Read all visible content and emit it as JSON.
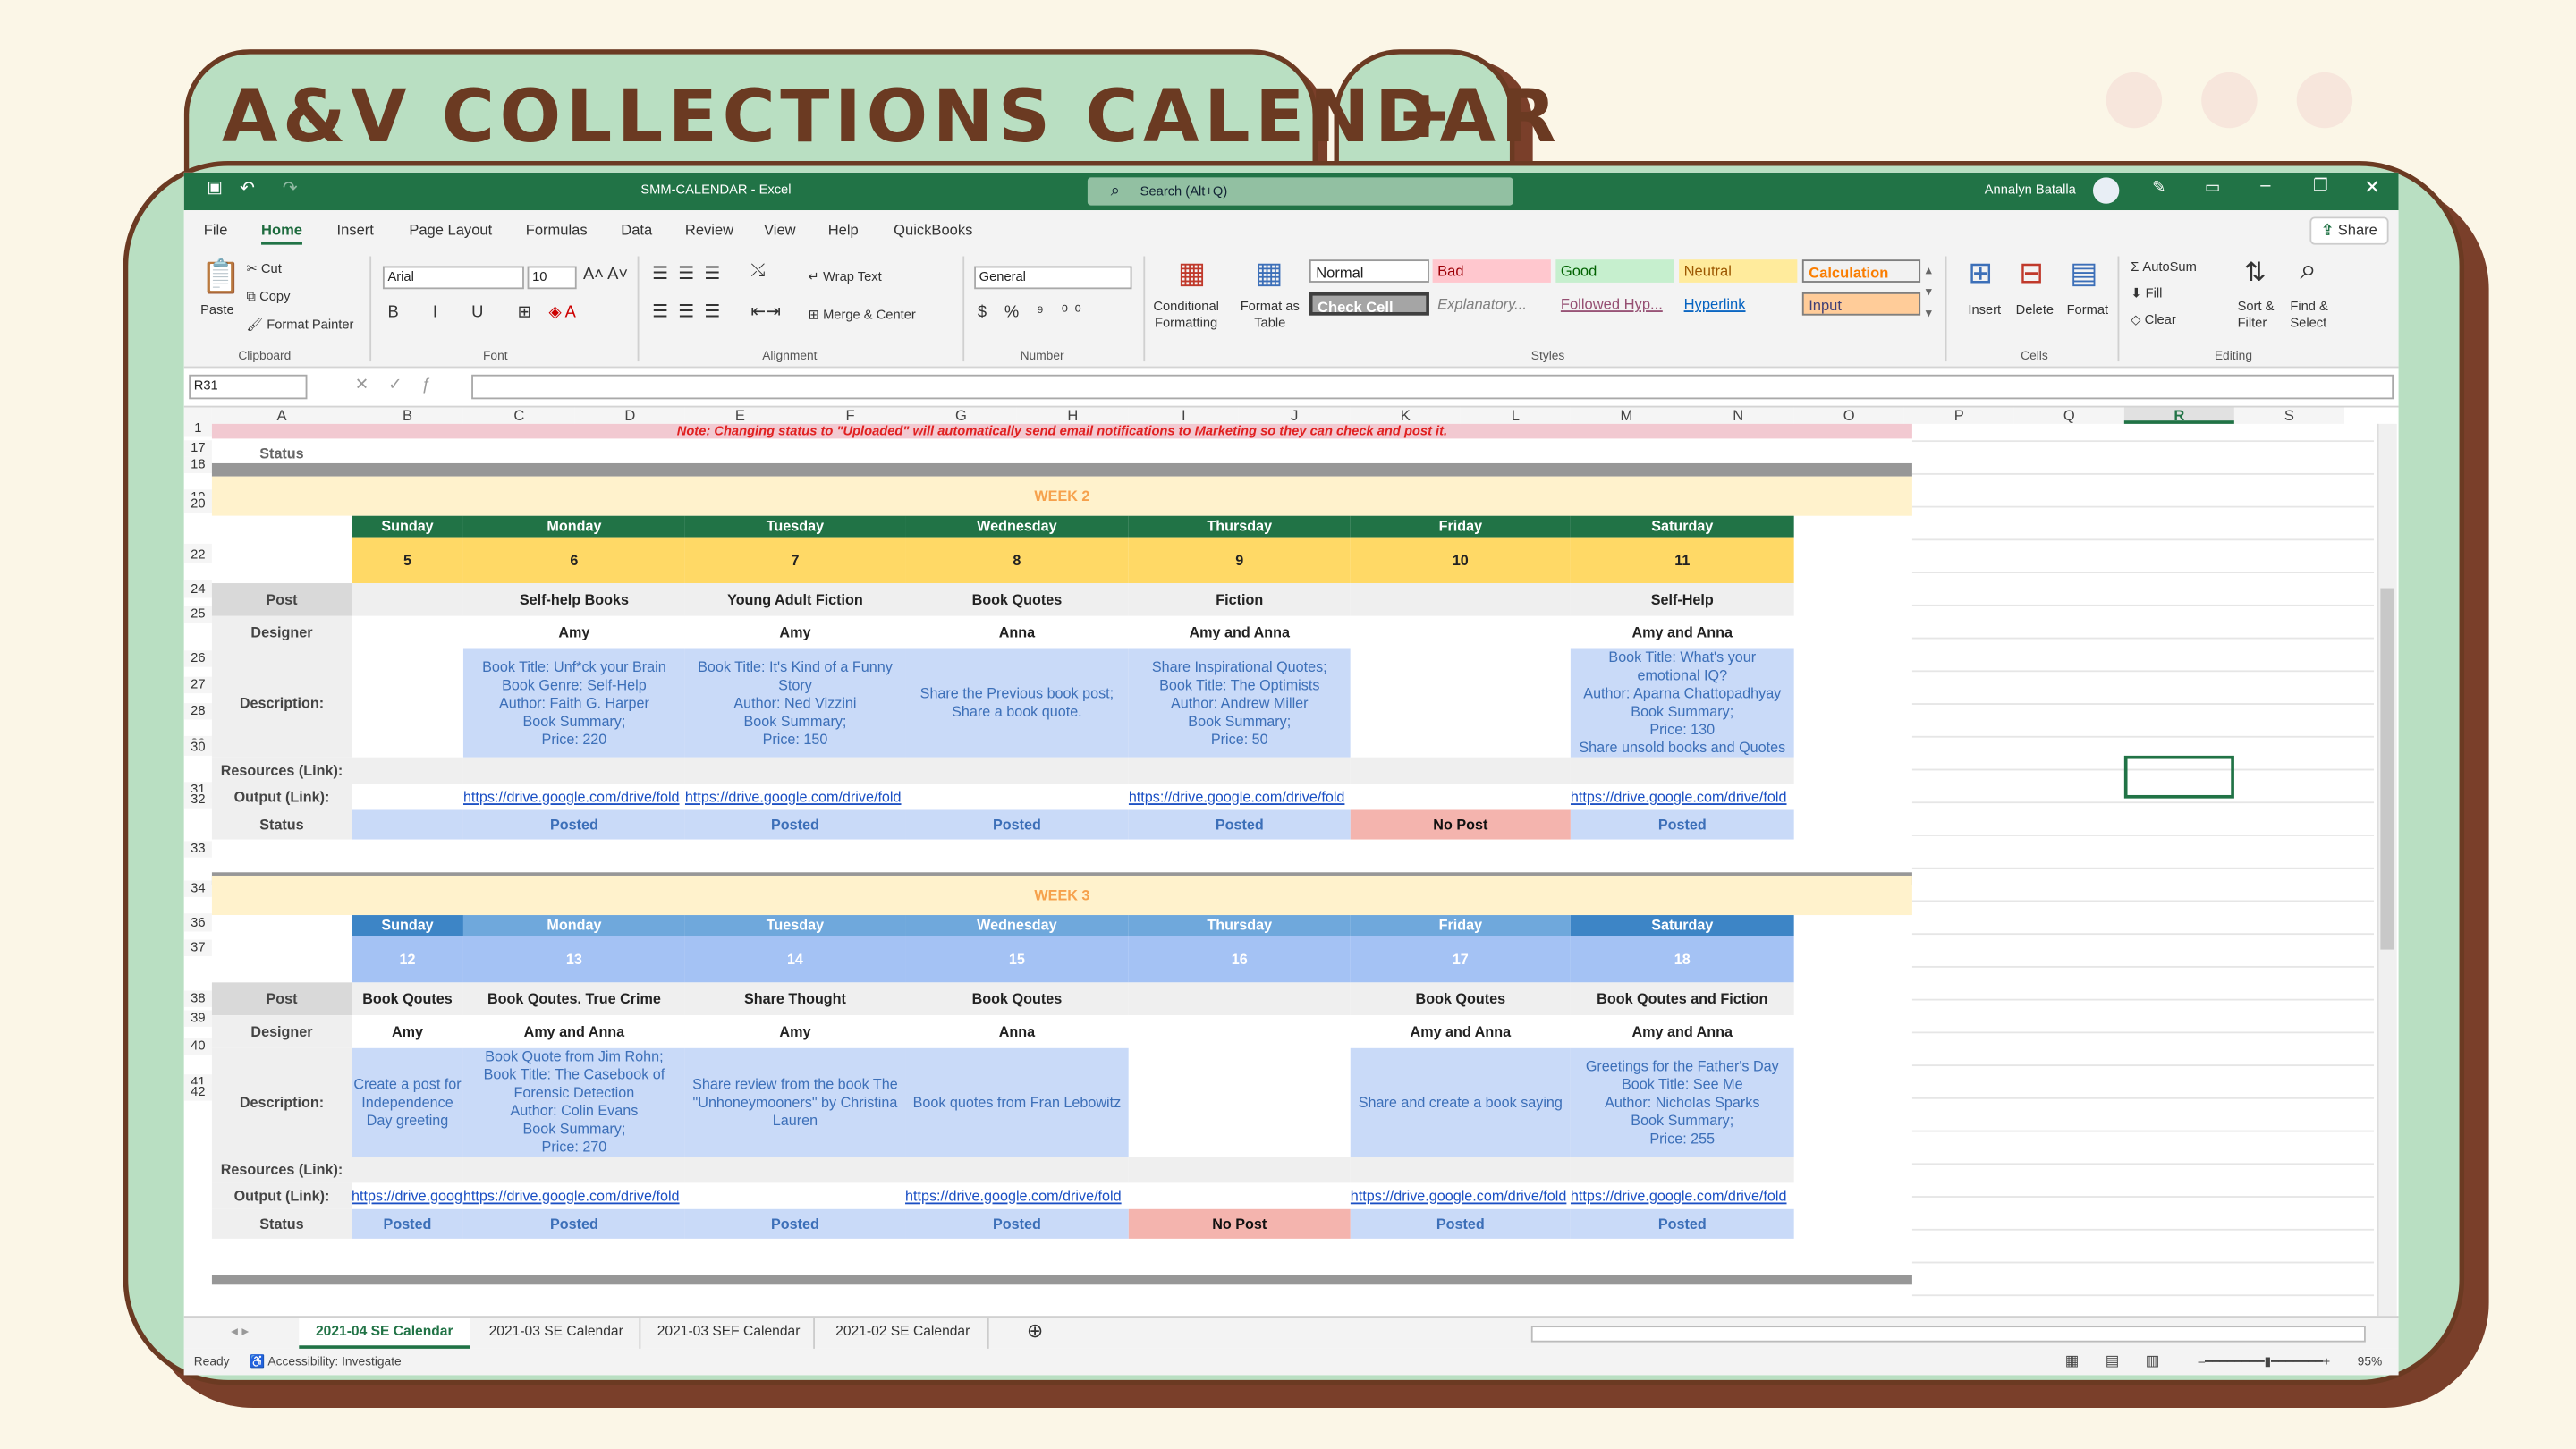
{
  "title": "A&V COLLECTIONS CALENDAR",
  "plus": "+",
  "window": {
    "title": "SMM-CALENDAR  -  Excel",
    "search": "Search (Alt+Q)",
    "user": "Annalyn Batalla"
  },
  "menu": [
    "File",
    "Home",
    "Insert",
    "Page Layout",
    "Formulas",
    "Data",
    "Review",
    "View",
    "Help",
    "QuickBooks"
  ],
  "share": "Share",
  "ribbon": {
    "clipboard": {
      "paste": "Paste",
      "cut": "Cut",
      "copy": "Copy",
      "format_painter": "Format Painter",
      "label": "Clipboard"
    },
    "font": {
      "name": "Arial",
      "size": "10",
      "label": "Font"
    },
    "alignment": {
      "wrap": "Wrap Text",
      "merge": "Merge & Center",
      "label": "Alignment"
    },
    "number": {
      "format": "General",
      "label": "Number"
    },
    "styles": {
      "cond": "Conditional\nFormatting",
      "table": "Format as\nTable",
      "normal": "Normal",
      "bad": "Bad",
      "good": "Good",
      "neutral": "Neutral",
      "calculation": "Calculation",
      "check": "Check Cell",
      "explanatory": "Explanatory...",
      "followed": "Followed Hyp...",
      "hyperlink": "Hyperlink",
      "input": "Input",
      "label": "Styles"
    },
    "cells": {
      "insert": "Insert",
      "delete": "Delete",
      "format": "Format",
      "label": "Cells"
    },
    "editing": {
      "autosum": "AutoSum",
      "fill": "Fill",
      "clear": "Clear",
      "sort": "Sort &\nFilter",
      "find": "Find &\nSelect",
      "label": "Editing"
    }
  },
  "namebox": "R31",
  "columns": [
    "A",
    "B",
    "C",
    "D",
    "E",
    "F",
    "G",
    "H",
    "I",
    "J",
    "K",
    "L",
    "M",
    "N",
    "O",
    "P",
    "Q",
    "R",
    "S"
  ],
  "note": "Note: Changing status to \"Uploaded\" will automatically send email notifications to Marketing so they can check and post it.",
  "labels": {
    "status": "Status",
    "post": "Post",
    "designer": "Designer",
    "description": "Description:",
    "resources": "Resources (Link):",
    "output": "Output (Link):"
  },
  "days": [
    "Sunday",
    "Monday",
    "Tuesday",
    "Wednesday",
    "Thursday",
    "Friday",
    "Saturday"
  ],
  "weeks": [
    {
      "title": "WEEK 2",
      "dates": [
        "5",
        "6",
        "7",
        "8",
        "9",
        "10",
        "11"
      ],
      "posts": [
        "",
        "Self-help Books",
        "Young Adult Fiction",
        "Book Quotes",
        "Fiction",
        "",
        "Self-Help"
      ],
      "designers": [
        "",
        "Amy",
        "Amy",
        "Anna",
        "Amy and Anna",
        "",
        "Amy and Anna"
      ],
      "descriptions": [
        "",
        "Book Title: Unf*ck your Brain\nBook Genre: Self-Help\nAuthor: Faith G. Harper\nBook Summary;\nPrice: 220",
        "Book Title: It's Kind of a Funny\nStory\nAuthor: Ned Vizzini\nBook Summary;\nPrice: 150",
        "Share the Previous book post;\nShare a book quote.",
        "Share Inspirational Quotes;\nBook Title: The Optimists\nAuthor: Andrew Miller\nBook Summary;\nPrice: 50",
        "",
        "Book Title: What's your\nemotional IQ?\nAuthor: Aparna Chattopadhyay\nBook Summary;\nPrice: 130\nShare unsold books and Quotes"
      ],
      "outputs": [
        "",
        "https://drive.google.com/drive/fold",
        "https://drive.google.com/drive/fold",
        "",
        "https://drive.google.com/drive/fold",
        "",
        "https://drive.google.com/drive/fold"
      ],
      "statuses": [
        "",
        "Posted",
        "Posted",
        "Posted",
        "Posted",
        "No Post",
        "Posted"
      ]
    },
    {
      "title": "WEEK 3",
      "dates": [
        "12",
        "13",
        "14",
        "15",
        "16",
        "17",
        "18"
      ],
      "posts": [
        "Book Qoutes",
        "Book Qoutes. True Crime",
        "Share Thought",
        "Book Qoutes",
        "",
        "Book Qoutes",
        "Book Qoutes and Fiction"
      ],
      "designers": [
        "Amy",
        "Amy and Anna",
        "Amy",
        "Anna",
        "",
        "Amy and Anna",
        "Amy and Anna"
      ],
      "descriptions": [
        "Create a post for Independence\nDay greeting",
        "Book Quote from Jim Rohn;\nBook Title: The Casebook of\nForensic Detection\nAuthor: Colin Evans\nBook Summary;\nPrice: 270",
        "Share review from the book The\n\"Unhoneymooners\" by Christina\nLauren",
        "Book quotes from Fran Lebowitz",
        "",
        "Share and create a book saying",
        "Greetings for the Father's Day\nBook Title: See Me\nAuthor: Nicholas Sparks\nBook Summary;\nPrice: 255"
      ],
      "outputs": [
        "https://drive.google.com/drive/fold",
        "https://drive.google.com/drive/fold",
        "",
        "https://drive.google.com/drive/fold",
        "",
        "https://drive.google.com/drive/fold",
        "https://drive.google.com/drive/fold"
      ],
      "statuses": [
        "Posted",
        "Posted",
        "Posted",
        "Posted",
        "No Post",
        "Posted",
        "Posted"
      ]
    }
  ],
  "sheets": [
    "2021-04 SE Calendar",
    "2021-03 SE Calendar",
    "2021-03 SEF Calendar",
    "2021-02 SE Calendar"
  ],
  "statusbar": {
    "ready": "Ready",
    "accessibility": "Accessibility: Investigate",
    "zoom": "95%"
  },
  "colors": {
    "green_header": "#217346",
    "week2_day": "#217346",
    "week3_day": "#3b78c4",
    "no_post": "#f4b4ae",
    "gold": "#ffd966"
  }
}
